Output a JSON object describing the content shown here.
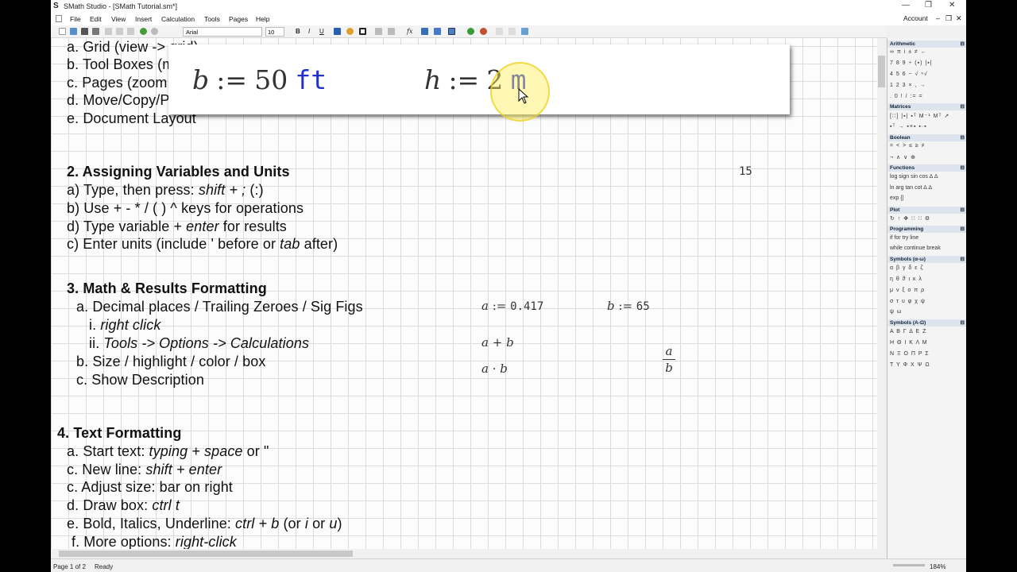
{
  "window": {
    "title": "SMath Studio - [SMath Tutorial.sm*]",
    "logo": "S",
    "controls": [
      "—",
      "❐",
      "✕"
    ]
  },
  "menu": {
    "items": [
      "File",
      "Edit",
      "View",
      "Insert",
      "Calculation",
      "Tools",
      "Pages",
      "Help"
    ],
    "account": "Account",
    "mdi_controls": [
      "–",
      "❐",
      "✕"
    ]
  },
  "toolbar": {
    "font": "Arial",
    "size": "10",
    "bold": "B",
    "italic": "I",
    "underline": "U",
    "fx": "fx"
  },
  "document": {
    "section1": [
      "a.  Grid  (view -> grid)",
      "b.  Tool Boxes (move/minimize)",
      "c.  Pages (zoom, switching)",
      "d.  Move/Copy/Paste/Align",
      "e.  Document Layout"
    ],
    "section2_title": "2. Assigning Variables and Units",
    "s2a_pre": "a)  Type, then press:  ",
    "s2a_it": "shift + ;",
    "s2a_post": "  (:)",
    "s2b": "b)  Use + - * / ( ) ^ keys for operations",
    "s2d_pre": "d)  Type variable + ",
    "s2d_it": "enter",
    "s2d_post": " for results",
    "s2c_pre": "c)  Enter units (include ' before or ",
    "s2c_it": "tab",
    "s2c_post": " after)",
    "partial_num": "15",
    "section3_title": "3. Math & Results Formatting",
    "s3a": "a.  Decimal places / Trailing Zeroes / Sig Figs",
    "s3ai_pre": "i.   ",
    "s3ai_it": "right click",
    "s3aii_pre": "ii.  ",
    "s3aii_it": "Tools -> Options -> Calculations",
    "s3b": "b.  Size / highlight / color / box",
    "s3c": "c.  Show Description",
    "section4_title": "4. Text Formatting",
    "s4a_pre": "a. Start text: ",
    "s4a_it": "typing + space",
    "s4a_post": "  or  \"",
    "s4c_pre": "c. New line:  ",
    "s4c_it": "shift + enter",
    "s4c2": "c. Adjust size: bar on right",
    "s4d_pre": "d. Draw box: ",
    "s4d_it": "ctrl t",
    "s4e_pre": "e. Bold, Italics, Underline:  ",
    "s4e_it": "ctrl + b",
    "s4e_mid": " (or ",
    "s4e_it2": "i",
    "s4e_mid2": " or ",
    "s4e_it3": "u",
    "s4e_post": ")",
    "s4f_pre": "f. More options:  ",
    "s4f_it": "right-click"
  },
  "math": {
    "a_var": "a",
    "assign": ":=",
    "a_val": "0.417",
    "b_var": "b",
    "b_val": "65",
    "sum_a": "a",
    "plus": "+",
    "sum_b": "b",
    "dot_a": "a",
    "dot": "·",
    "dot_b": "b",
    "frac_num": "a",
    "frac_den": "b"
  },
  "zoom": {
    "b_var": "b",
    "assign": ":=",
    "b_val": "50",
    "b_unit": "ft",
    "h_var": "h",
    "h_val": "2",
    "h_unit": "m"
  },
  "panel": {
    "arithmetic": {
      "title": "Arithmetic",
      "rows": [
        "∞  π  i  ±  ≠  ←",
        "7  8  9  ÷  (▪)  |▪|",
        "4  5  6  −  √  ⁿ√",
        "1  2  3  ×  ,  →",
        ".  0  !  /  :=  ="
      ]
    },
    "matrices": {
      "title": "Matrices",
      "rows": [
        "[∷] |▪| ▪ᵀ M⁻¹ Mᵀ ↗",
        "▪ᵀ → ▪×▪ ▪·▪"
      ]
    },
    "boolean": {
      "title": "Boolean",
      "rows": [
        "=  <  >  ≤  ≥  ≠",
        "¬  ∧  ∨  ⊕"
      ]
    },
    "functions": {
      "title": "Functions",
      "rows": [
        "log sign sin cos  ∆  ∆",
        "ln  arg tan cot  ∆  ∆",
        "exp {|"
      ]
    },
    "plot": {
      "title": "Plot",
      "rows": [
        "↻  ↑  ✥  ∷  ∷  ⚙"
      ]
    },
    "programming": {
      "title": "Programming",
      "rows": [
        "if   for    try       line",
        "while continue break"
      ]
    },
    "greek_lower": {
      "title": "Symbols (α-ω)",
      "rows": [
        "α β γ δ ε ζ",
        "η θ ϑ ι κ λ",
        "μ ν ξ ο π ρ",
        "σ τ υ φ χ ψ",
        "ψ ω"
      ]
    },
    "greek_upper": {
      "title": "Symbols (Α-Ω)",
      "rows": [
        "Α Β Γ Δ Ε Ζ",
        "Η Θ Ι Κ Λ Μ",
        "Ν Ξ Ο Π Ρ Σ",
        "Τ Υ Φ Χ Ψ Ω"
      ]
    }
  },
  "status": {
    "page": "Page 1 of 2",
    "state": "Ready",
    "zoom": "184%"
  }
}
